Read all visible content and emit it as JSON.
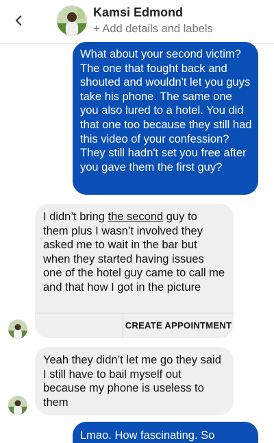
{
  "header": {
    "back_icon": "chevron-left-icon",
    "contact_name": "Kamsi Edmond",
    "subtitle": "+ Add details and labels"
  },
  "colors": {
    "outgoing_bubble": "#0a4fb5",
    "incoming_bubble": "#efefef"
  },
  "messages": [
    {
      "direction": "outgoing",
      "text": "What about your second victim? The one that fought back and shouted and wouldn't let you guys take his phone. The same one you also lured to a hotel. You did that one too because they still had this video of your confession? They still hadn't set you free after you gave them the first guy?"
    },
    {
      "direction": "incoming",
      "text_before": "I didn’t bring ",
      "text_underlined": "the second",
      "text_after": " guy to them plus I wasn’t involved they asked me to wait in the bar but when they started having issues one of the hotel guy came to call me and that how I got in the picture",
      "action_label": "CREATE APPOINTMENT"
    },
    {
      "direction": "incoming",
      "text": "Yeah they didn’t let me go they said I still have to bail myself out because my phone is useless to them"
    },
    {
      "direction": "outgoing",
      "text": "Lmao. How fascinating. So"
    }
  ]
}
